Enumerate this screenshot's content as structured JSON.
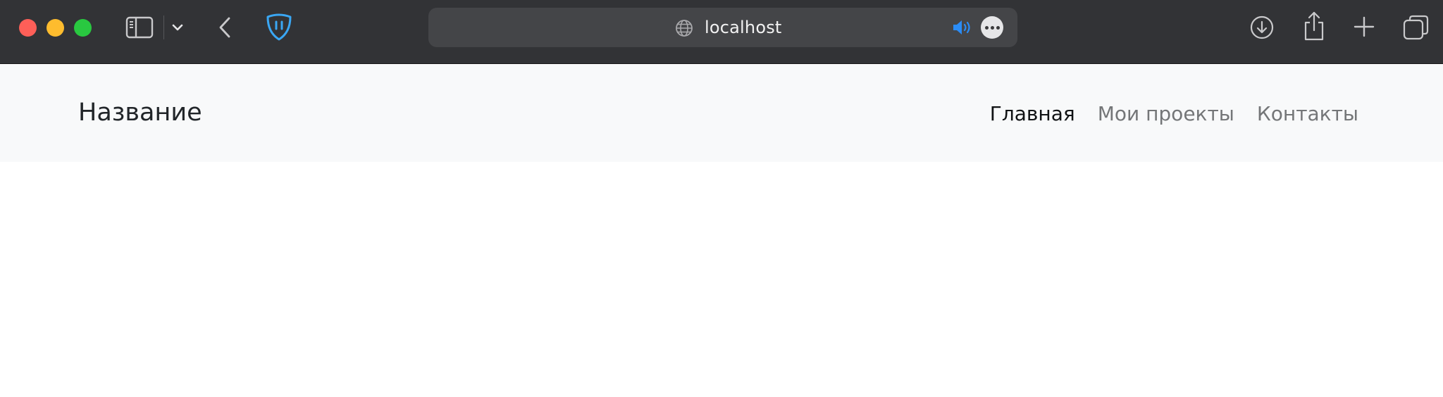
{
  "browser": {
    "address_bar": {
      "url": "localhost"
    },
    "icons": {
      "sidebar": "sidebar-toggle-icon",
      "chevron": "chevron-down-icon",
      "back": "chevron-left-icon",
      "shield": "privacy-shield-icon",
      "globe": "globe-icon",
      "speaker": "speaker-icon",
      "more": "ellipsis-icon",
      "download": "download-icon",
      "share": "share-icon",
      "new_tab": "plus-icon",
      "tabs": "tabs-overview-icon"
    },
    "colors": {
      "toolbar_bg": "#323336",
      "address_bg": "#444548",
      "close": "#fe5f58",
      "minimize": "#febc2e",
      "maximize": "#29c840",
      "shield_accent": "#3aa7f4",
      "speaker_accent": "#2b8cf5"
    }
  },
  "page": {
    "navbar": {
      "brand": "Название",
      "links": [
        {
          "label": "Главная",
          "active": true
        },
        {
          "label": "Мои проекты",
          "active": false
        },
        {
          "label": "Контакты",
          "active": false
        }
      ]
    },
    "colors": {
      "navbar_bg": "#f8f9fa",
      "link_active": "#101214",
      "link_inactive": "#747678"
    }
  }
}
